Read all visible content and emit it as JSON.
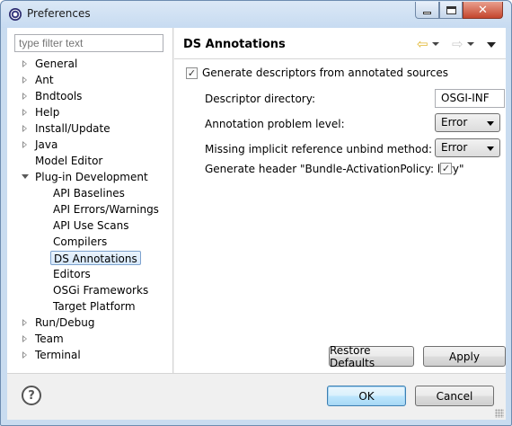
{
  "window": {
    "title": "Preferences"
  },
  "filter": {
    "placeholder": "type filter text"
  },
  "tree": {
    "items": [
      {
        "label": "General",
        "expandable": true
      },
      {
        "label": "Ant",
        "expandable": true
      },
      {
        "label": "Bndtools",
        "expandable": true
      },
      {
        "label": "Help",
        "expandable": true
      },
      {
        "label": "Install/Update",
        "expandable": true
      },
      {
        "label": "Java",
        "expandable": true
      },
      {
        "label": "Model Editor",
        "expandable": false
      },
      {
        "label": "Plug-in Development",
        "expandable": true,
        "expanded": true
      },
      {
        "label": "API Baselines",
        "child": true
      },
      {
        "label": "API Errors/Warnings",
        "child": true
      },
      {
        "label": "API Use Scans",
        "child": true
      },
      {
        "label": "Compilers",
        "child": true
      },
      {
        "label": "DS Annotations",
        "child": true,
        "selected": true
      },
      {
        "label": "Editors",
        "child": true
      },
      {
        "label": "OSGi Frameworks",
        "child": true
      },
      {
        "label": "Target Platform",
        "child": true
      },
      {
        "label": "Run/Debug",
        "expandable": true
      },
      {
        "label": "Team",
        "expandable": true
      },
      {
        "label": "Terminal",
        "expandable": true
      }
    ]
  },
  "page": {
    "title": "DS Annotations",
    "generate_label": "Generate descriptors from annotated sources",
    "generate_checked": true,
    "descriptor_dir_label": "Descriptor directory:",
    "descriptor_dir_value": "OSGI-INF",
    "problem_level_label": "Annotation problem level:",
    "problem_level_value": "Error",
    "unbind_label": "Missing implicit reference unbind method:",
    "unbind_value": "Error",
    "lazy_label": "Generate header \"Bundle-ActivationPolicy: lazy\"",
    "lazy_checked": true
  },
  "buttons": {
    "restore": "Restore Defaults",
    "apply": "Apply",
    "ok": "OK",
    "cancel": "Cancel"
  },
  "icons": {
    "nav_back": "back-arrow-icon",
    "nav_forward": "forward-arrow-icon",
    "help": "help-icon",
    "check_mark": "✓"
  },
  "colors": {
    "back_arrow": "#e1b732",
    "selection_border": "#7da2ce"
  }
}
